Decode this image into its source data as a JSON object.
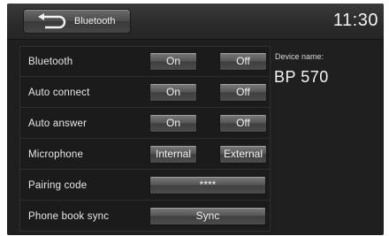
{
  "header": {
    "back_label": "Bluetooth",
    "clock": "11:30"
  },
  "settings": [
    {
      "label": "Bluetooth",
      "options": [
        "On",
        "Off"
      ]
    },
    {
      "label": "Auto connect",
      "options": [
        "On",
        "Off"
      ]
    },
    {
      "label": "Auto answer",
      "options": [
        "On",
        "Off"
      ]
    },
    {
      "label": "Microphone",
      "options": [
        "Internal",
        "External"
      ]
    },
    {
      "label": "Pairing code",
      "value": "****"
    },
    {
      "label": "Phone book sync",
      "action": "Sync"
    }
  ],
  "device": {
    "label": "Device name:",
    "name": "BP 570"
  }
}
